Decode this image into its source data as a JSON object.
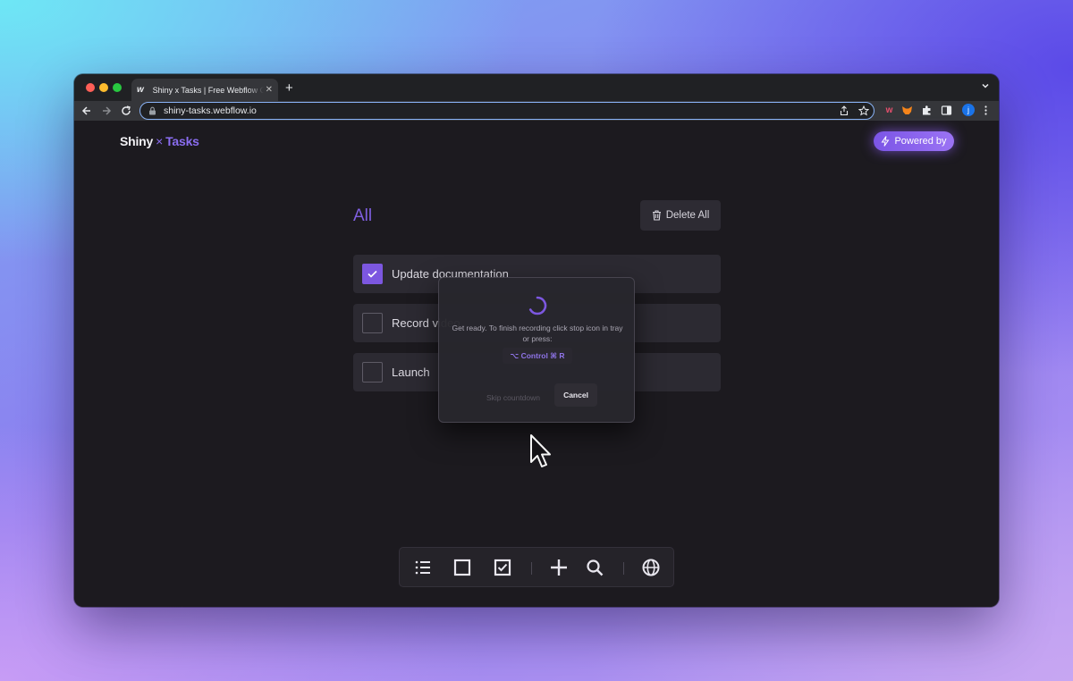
{
  "browser": {
    "tab": {
      "favicon": "w",
      "title": "Shiny x Tasks | Free Webflow C",
      "close": "✕"
    },
    "new_tab": "+",
    "url": "shiny-tasks.webflow.io",
    "profile_initial": "j",
    "extensions": [
      "webflow-w-icon",
      "metamask-fox-icon",
      "puzzle-icon",
      "sidebar-icon"
    ]
  },
  "header": {
    "brand_shiny": "Shiny",
    "brand_x": "×",
    "brand_tasks": "Tasks",
    "powered_by": "Powered by"
  },
  "main": {
    "heading": "All",
    "delete_all": "Delete All",
    "tasks": [
      {
        "label": "Update documentation",
        "checked": true
      },
      {
        "label": "Record video",
        "checked": false
      },
      {
        "label": "Launch",
        "checked": false
      }
    ]
  },
  "recording_modal": {
    "message": "Get ready. To finish recording click stop icon in tray or press:",
    "shortcut": "⌥ Control ⌘ R",
    "skip": "Skip countdown",
    "cancel": "Cancel"
  },
  "dock": {
    "items": [
      "list-icon",
      "square-icon",
      "checked-square-icon",
      "plus-icon",
      "search-icon",
      "globe-icon"
    ]
  },
  "colors": {
    "accent": "#7c57e0",
    "page_bg": "#1c1a1f",
    "card_bg": "#2c2a32"
  }
}
